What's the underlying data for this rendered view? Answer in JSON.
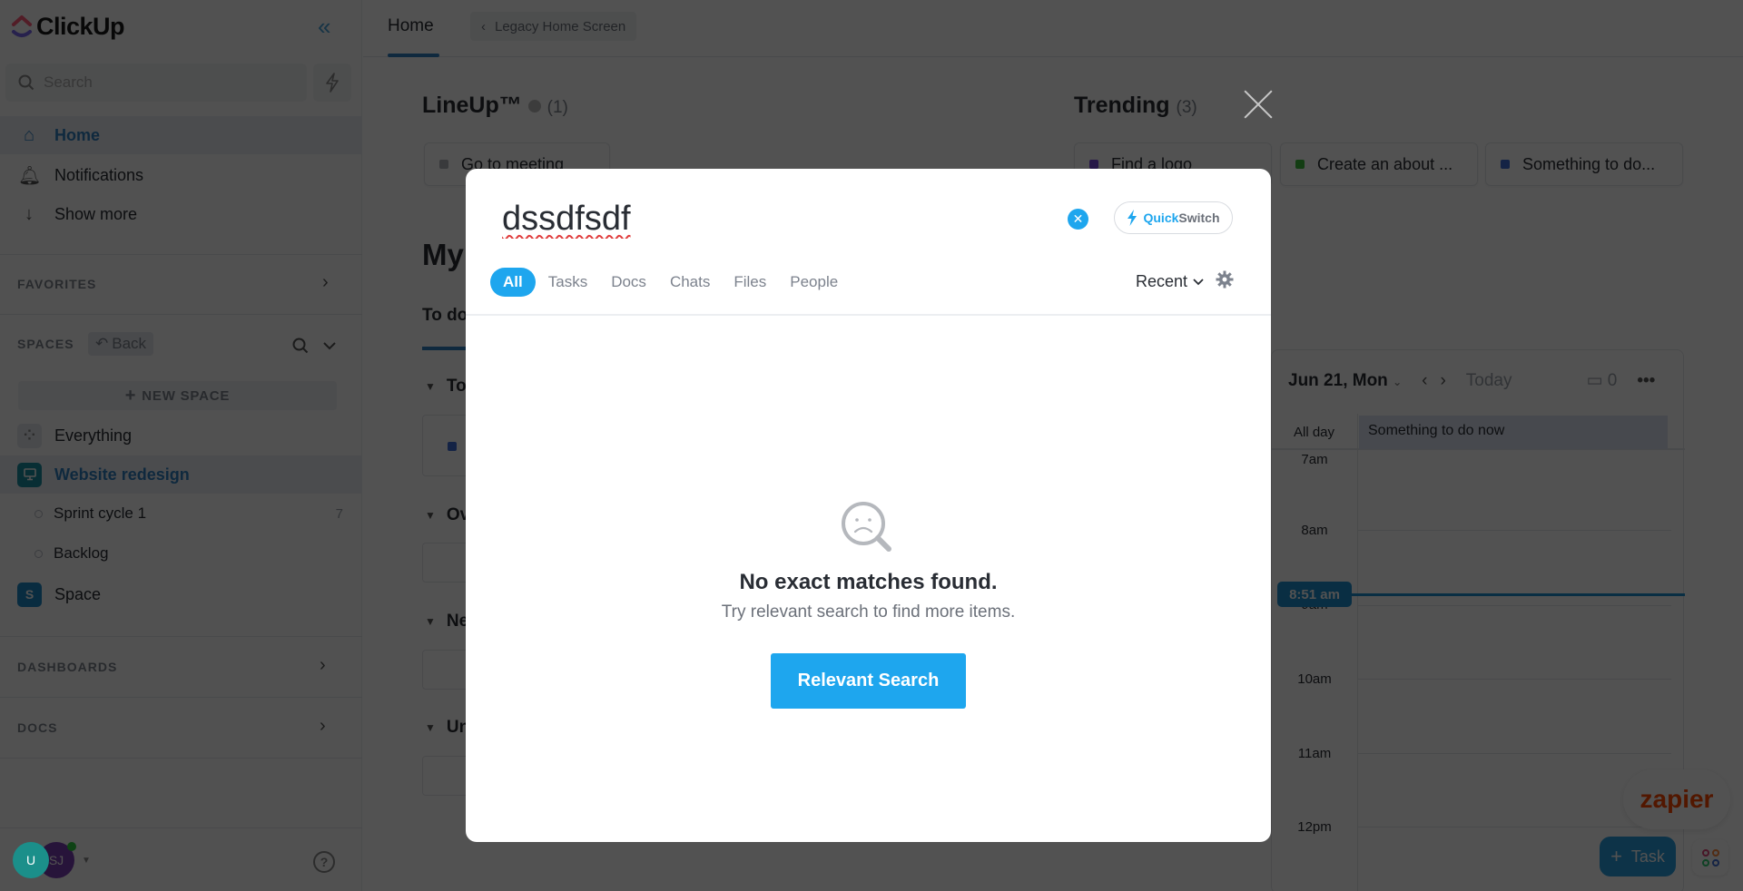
{
  "app": {
    "name": "ClickUp"
  },
  "sidebar": {
    "search_placeholder": "Search",
    "nav": [
      {
        "label": "Home",
        "icon": "home-icon",
        "active": true
      },
      {
        "label": "Notifications",
        "icon": "bell-icon"
      },
      {
        "label": "Show more",
        "icon": "arrow-down-icon"
      }
    ],
    "favorites_label": "FAVORITES",
    "spaces_label": "SPACES",
    "back_label": "Back",
    "new_space_label": "NEW SPACE",
    "spaces": [
      {
        "label": "Everything",
        "icon": "grid-icon"
      },
      {
        "label": "Website redesign",
        "icon": "monitor-icon",
        "active": true,
        "color": "#1a8fa3"
      },
      {
        "label": "Space",
        "badge": "S",
        "color": "#1e88c7"
      }
    ],
    "lists": [
      {
        "label": "Sprint cycle 1",
        "count": "7"
      },
      {
        "label": "Backlog",
        "count": ""
      }
    ],
    "dashboards_label": "DASHBOARDS",
    "docs_label": "DOCS",
    "avatars": [
      {
        "initials": "U",
        "color": "#1b8f8a"
      },
      {
        "initials": "SJ",
        "color": "#7b3fb3"
      }
    ]
  },
  "topbar": {
    "home_tab": "Home",
    "legacy_label": "Legacy Home Screen"
  },
  "home": {
    "lineup": {
      "title": "LineUp™",
      "count": "(1)",
      "items": [
        {
          "label": "Go to meeting",
          "color": "#b0b4ba"
        }
      ]
    },
    "trending": {
      "title": "Trending",
      "count": "(3)",
      "items": [
        {
          "label": "Find a logo",
          "color": "#7b4ce0"
        },
        {
          "label": "Create an about ...",
          "color": "#3dbd3d"
        },
        {
          "label": "Something to do...",
          "color": "#3f6fd6"
        }
      ]
    },
    "my_work": {
      "title": "My",
      "tab": "To do",
      "groups": [
        "To",
        "Ov",
        "Ne",
        "Un"
      ]
    },
    "calendar": {
      "date": "Jun 21, Mon",
      "today": "Today",
      "count": "0",
      "all_day_label": "All day",
      "all_day_event": "Something to do now",
      "hours": [
        "7am",
        "8am",
        "9am",
        "10am",
        "11am",
        "12pm"
      ],
      "now": "8:51 am"
    },
    "zapier_label": "zapier",
    "task_button": "Task"
  },
  "search_modal": {
    "query": "dssdfsdf",
    "quickswitch": {
      "quick": "Quick",
      "switch": "Switch"
    },
    "tabs": [
      {
        "label": "All",
        "active": true
      },
      {
        "label": "Tasks"
      },
      {
        "label": "Docs"
      },
      {
        "label": "Chats"
      },
      {
        "label": "Files"
      },
      {
        "label": "People"
      }
    ],
    "sort_label": "Recent",
    "empty_title": "No exact matches found.",
    "empty_subtitle": "Try relevant search to find more items.",
    "relevant_button": "Relevant Search",
    "accent_color": "#1ea6ee"
  }
}
